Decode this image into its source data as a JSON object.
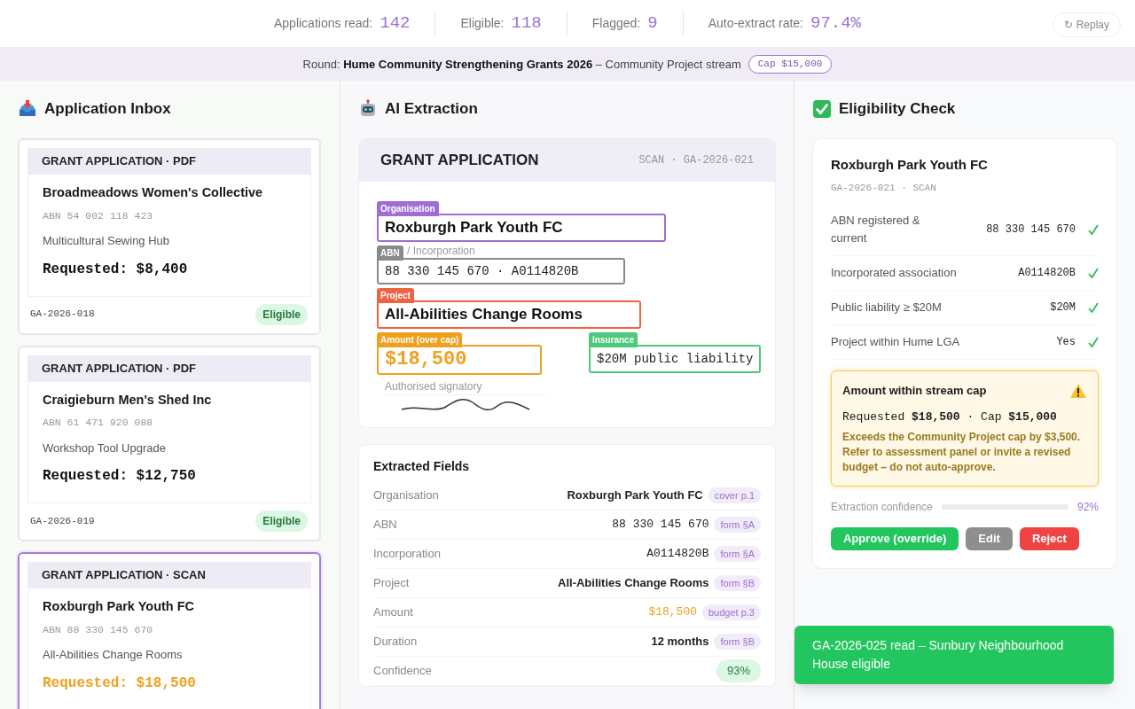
{
  "stats": [
    {
      "label": "Applications read:",
      "value": "142"
    },
    {
      "label": "Eligible:",
      "value": "118"
    },
    {
      "label": "Flagged:",
      "value": "9"
    },
    {
      "label": "Auto-extract rate:",
      "value": "97.4%"
    }
  ],
  "replay_button": "↻ Replay",
  "round_bar": {
    "prefix": "Round:",
    "round": "Hume Community Strengthening Grants 2026",
    "stream": "– Community Project stream",
    "cap": "Cap $15,000"
  },
  "inbox": {
    "title": "Application Inbox",
    "cards": [
      {
        "header": "GRANT APPLICATION · PDF",
        "org": "Broadmeadows Women's Collective",
        "abn": "ABN 54 002 118 423",
        "project": "Multicultural Sewing Hub",
        "requested": "Requested: $8,400",
        "id": "GA-2026-018",
        "status": "Eligible",
        "selected": false,
        "flagged": false
      },
      {
        "header": "GRANT APPLICATION · PDF",
        "org": "Craigieburn Men's Shed Inc",
        "abn": "ABN 61 471 920 088",
        "project": "Workshop Tool Upgrade",
        "requested": "Requested: $12,750",
        "id": "GA-2026-019",
        "status": "Eligible",
        "selected": false,
        "flagged": false
      },
      {
        "header": "GRANT APPLICATION · SCAN",
        "org": "Roxburgh Park Youth FC",
        "abn": "ABN 88 330 145 670",
        "project": "All-Abilities Change Rooms",
        "requested": "Requested: $18,500",
        "selected": true,
        "flagged": true
      }
    ]
  },
  "extraction": {
    "title": "AI Extraction",
    "document": {
      "title": "GRANT APPLICATION",
      "meta": "SCAN · GA-2026-021",
      "fields": [
        {
          "tag": "Organisation",
          "color": "#a06cd5",
          "value": "Roxburgh Park Youth FC",
          "kind": "large"
        },
        {
          "tag": "ABN",
          "color": "#8a8a8a",
          "under": "/ Incorporation",
          "value": "88 330 145 670 · A0114820B",
          "kind": "mono"
        },
        {
          "tag": "Project",
          "color": "#ef6342",
          "value": "All-Abilities Change Rooms",
          "kind": "large"
        }
      ],
      "amount": {
        "tag": "Amount (over cap)",
        "color": "#f0a020",
        "value": "$18,500"
      },
      "insurance": {
        "tag": "Insurance",
        "color": "#4cc97a",
        "value": "$20M public liability"
      },
      "signatory": "Authorised signatory"
    },
    "fields_title": "Extracted Fields",
    "rows": [
      {
        "label": "Organisation",
        "value": "Roxburgh Park Youth FC",
        "source": "cover p.1",
        "kind": "text"
      },
      {
        "label": "ABN",
        "value": "88 330 145 670",
        "source": "form §A",
        "kind": "mono"
      },
      {
        "label": "Incorporation",
        "value": "A0114820B",
        "source": "form §A",
        "kind": "mono"
      },
      {
        "label": "Project",
        "value": "All-Abilities Change Rooms",
        "source": "form §B",
        "kind": "text"
      },
      {
        "label": "Amount",
        "value": "$18,500",
        "source": "budget p.3",
        "kind": "warn"
      },
      {
        "label": "Duration",
        "value": "12 months",
        "source": "form §B",
        "kind": "text"
      },
      {
        "label": "Confidence",
        "value": "93%",
        "kind": "badge"
      }
    ]
  },
  "eligibility": {
    "title": "Eligibility Check",
    "org": "Roxburgh Park Youth FC",
    "meta": "GA-2026-021 · SCAN",
    "checks": [
      {
        "label": "ABN registered & current",
        "value": "88 330 145 670",
        "passed": true
      },
      {
        "label": "Incorporated association",
        "value": "A0114820B",
        "passed": true
      },
      {
        "label": "Public liability ≥ $20M",
        "value": "$20M",
        "passed": true
      },
      {
        "label": "Project within Hume LGA",
        "value": "Yes",
        "passed": true
      }
    ],
    "warning": {
      "title": "Amount within stream cap",
      "req_label": "Requested",
      "req": "$18,500",
      "sep": "·",
      "cap_label": "Cap",
      "cap": "$15,000",
      "text": "Exceeds the Community Project cap by $3,500. Refer to assessment panel or invite a revised budget – do not auto-approve."
    },
    "confidence": {
      "label": "Extraction confidence",
      "reading": "92%"
    },
    "buttons": [
      {
        "label": "Approve (override)",
        "kind": "approve"
      },
      {
        "label": "Edit",
        "kind": "edit"
      },
      {
        "label": "Reject",
        "kind": "reject"
      }
    ]
  },
  "toast": "GA-2026-025 read – Sunbury Neighbourhood House eligible"
}
